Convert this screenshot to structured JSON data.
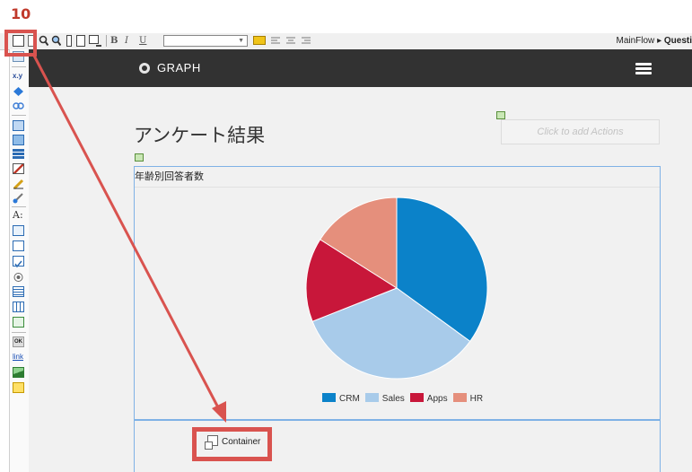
{
  "annotation": {
    "step_number": "10",
    "color": "#d9534f"
  },
  "toolbar": {
    "bold": "B",
    "italic": "I",
    "underline": "U",
    "font_select_value": "",
    "breadcrumb_app": "MainFlow",
    "breadcrumb_separator": "▸",
    "breadcrumb_page": "Questi"
  },
  "palette": {
    "items": [
      "container-icon",
      "table-icon",
      "xy-variable-icon",
      "diamond-icon",
      "link-chain-icon",
      "form-icon",
      "list-icon",
      "stack-icon",
      "edit-icon",
      "pencil-icon",
      "brush-icon",
      "font-icon",
      "textbox-icon",
      "input-icon",
      "checkbox-icon",
      "radio-icon",
      "grid-icon",
      "grid-alt-icon",
      "plugin-icon",
      "ok-button-icon",
      "link-icon",
      "image-icon",
      "note-icon"
    ],
    "xy_label": "x.y",
    "font_label": "A:",
    "ok_label": "OK",
    "link_label": "link"
  },
  "app": {
    "title": "GRAPH",
    "page_title": "アンケート結果",
    "actions_placeholder": "Click to add Actions"
  },
  "chart_panel": {
    "title": "年齢別回答者数"
  },
  "container": {
    "label": "Container"
  },
  "chart_data": {
    "type": "pie",
    "title": "年齢別回答者数",
    "categories": [
      "CRM",
      "Sales",
      "Apps",
      "HR"
    ],
    "values": [
      35,
      34,
      15,
      16
    ],
    "colors": [
      "#0b82c9",
      "#a8cbea",
      "#c8173a",
      "#e58f7c"
    ],
    "legend": "bottom"
  }
}
